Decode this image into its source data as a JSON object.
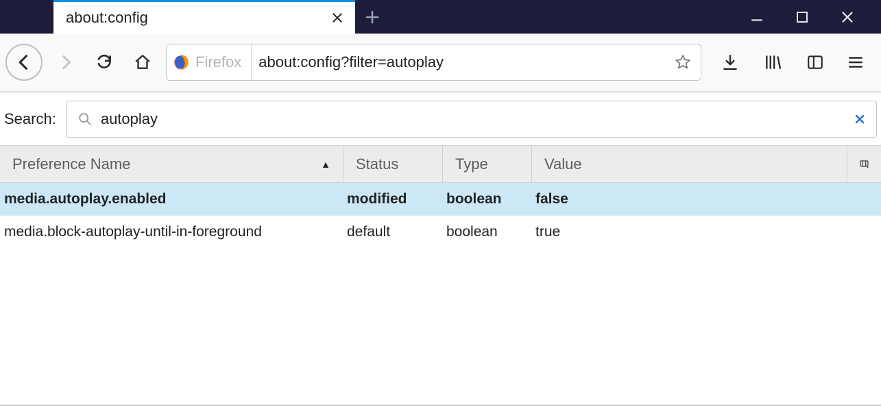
{
  "window": {
    "tab_title": "about:config",
    "url": "about:config?filter=autoplay",
    "brand": "Firefox"
  },
  "config_page": {
    "search_label": "Search:",
    "search_value": "autoplay",
    "columns": {
      "name": "Preference Name",
      "status": "Status",
      "type": "Type",
      "value": "Value"
    },
    "rows": [
      {
        "name": "media.autoplay.enabled",
        "status": "modified",
        "type": "boolean",
        "value": "false",
        "selected": true
      },
      {
        "name": "media.block-autoplay-until-in-foreground",
        "status": "default",
        "type": "boolean",
        "value": "true",
        "selected": false
      }
    ]
  }
}
